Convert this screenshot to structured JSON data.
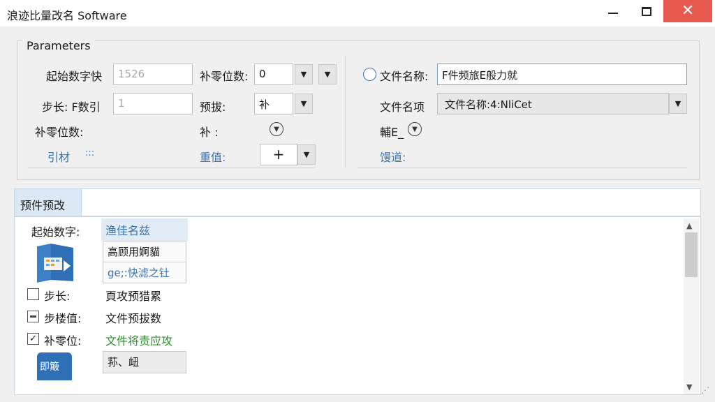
{
  "window": {
    "title": "浪迹比量改名 Software",
    "min_label": "",
    "max_label": "",
    "close_glyph": "✕"
  },
  "parameters": {
    "legend": "Parameters",
    "start_number_label": "起始数字快",
    "start_number_value": "1526",
    "pad_zeros_label": "补零位数:",
    "pad_zeros_value": "0",
    "step_label": "步长: F数引",
    "step_value": "1",
    "preset_label": "预拔:",
    "preset_value": "补",
    "pad_zeros_label2": "补零位数:",
    "supplement_label": "补 :",
    "meta_label": "引材",
    "meta_dots": ":::",
    "reset_label": "重值:",
    "file_name_radio_label": "文件名称:",
    "file_name_value": "F件频旅E般力就",
    "file_name_item_label": "文件名项",
    "file_name_item_value": "文件名称:4:NliCet",
    "ext_label": "輔E_",
    "channel_label": "馒道:",
    "plus_glyph": "+"
  },
  "preview": {
    "tab_label": "预件预改",
    "rows": [
      {
        "label": "起始数字:",
        "value": "渔佳名兹"
      },
      {
        "label": "步长:",
        "value": "頁攻预猎累"
      },
      {
        "label": "步楼值:",
        "value": "文件预拔数"
      },
      {
        "label": "补零位:",
        "value": "文件将责应攻"
      }
    ],
    "card1": [
      "高顾用婀貓",
      "ge;:快滤之钍"
    ],
    "card2": "荪、衄",
    "thumb_text": "即簸"
  },
  "icons": {
    "chevron_down": "chevron-down-icon",
    "circle_chevron": "circle-chevron-icon",
    "radio": "radio-icon",
    "plus": "plus-icon",
    "file_icon": "file-preview-icon",
    "check": "check-icon"
  },
  "colors": {
    "accent": "#3b73b0",
    "close_button": "#e85a50",
    "green_text": "#2e8b2e",
    "tab_bg": "#dce8f4"
  }
}
